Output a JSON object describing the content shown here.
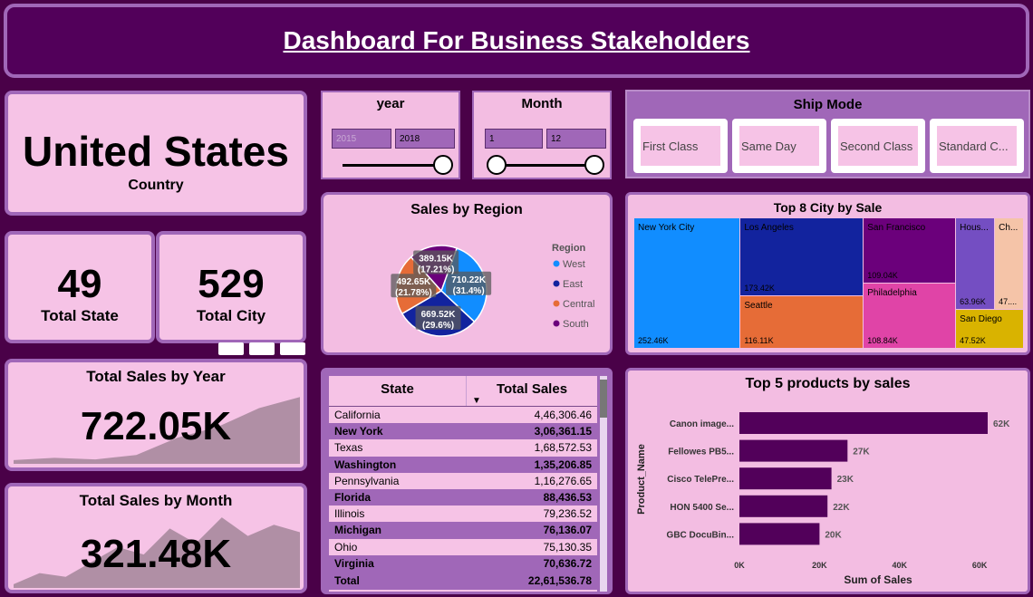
{
  "header": {
    "title": "Dashboard For Business Stakeholders"
  },
  "kpis": {
    "country": {
      "value": "United States",
      "label": "Country"
    },
    "total_state": {
      "value": "49",
      "label": "Total State"
    },
    "total_city": {
      "value": "529",
      "label": "Total City"
    },
    "sales_by_year": {
      "title": "Total Sales by Year",
      "value": "722.05K"
    },
    "sales_by_month": {
      "title": "Total Sales by Month",
      "value": "321.48K"
    }
  },
  "slicers": {
    "year": {
      "title": "year",
      "min": "2015",
      "max": "2018"
    },
    "month": {
      "title": "Month",
      "min": "1",
      "max": "12"
    },
    "ship_mode": {
      "title": "Ship Mode",
      "options": [
        "First Class",
        "Same Day",
        "Second Class",
        "Standard C..."
      ]
    }
  },
  "sales_by_region": {
    "title": "Sales by Region",
    "legend_title": "Region",
    "colors": [
      "#118dff",
      "#12239e",
      "#e66c37",
      "#6b007b"
    ]
  },
  "state_table": {
    "headers": [
      "State",
      "Total Sales"
    ],
    "rows": [
      [
        "California",
        "4,46,306.46"
      ],
      [
        "New York",
        "3,06,361.15"
      ],
      [
        "Texas",
        "1,68,572.53"
      ],
      [
        "Washington",
        "1,35,206.85"
      ],
      [
        "Pennsylvania",
        "1,16,276.65"
      ],
      [
        "Florida",
        "88,436.53"
      ],
      [
        "Illinois",
        "79,236.52"
      ],
      [
        "Michigan",
        "76,136.07"
      ],
      [
        "Ohio",
        "75,130.35"
      ],
      [
        "Virginia",
        "70,636.72"
      ]
    ],
    "total_label": "Total",
    "total_value": "22,61,536.78"
  },
  "top_cities": {
    "title": "Top 8 City by Sale"
  },
  "top_products": {
    "title": "Top 5 products by sales"
  },
  "chart_data": [
    {
      "type": "pie",
      "title": "Sales by Region",
      "legend_title": "Region",
      "categories": [
        "West",
        "East",
        "Central",
        "South"
      ],
      "values": [
        710.22,
        669.52,
        492.65,
        389.15
      ],
      "labels": [
        "710.22K\n(31.4%)",
        "669.52K\n(29.6%)",
        "492.65K\n(21.78%)",
        "389.15K\n(17.21%)"
      ],
      "unit": "K"
    },
    {
      "type": "treemap",
      "title": "Top 8 City by Sale",
      "categories": [
        "New York City",
        "Los Angeles",
        "San Francisco",
        "Hous...",
        "Ch...",
        "Seattle",
        "Philadelphia",
        "San Diego"
      ],
      "values": [
        252.46,
        173.42,
        109.04,
        63.96,
        47.0,
        116.11,
        108.84,
        47.52
      ],
      "labels": [
        "252.46K",
        "173.42K",
        "109.04K",
        "63.96K",
        "47....",
        "116.11K",
        "108.84K",
        "47.52K"
      ],
      "colors": [
        "#118dff",
        "#12239e",
        "#6b007b",
        "#744ec2",
        "#f5c4a8",
        "#e66c37",
        "#e044a7",
        "#d9b300"
      ]
    },
    {
      "type": "bar",
      "orientation": "horizontal",
      "title": "Top 5 products by sales",
      "categories": [
        "Canon image...",
        "Fellowes PB5...",
        "Cisco TelePre...",
        "HON 5400 Se...",
        "GBC DocuBin..."
      ],
      "values": [
        62,
        27,
        23,
        22,
        20
      ],
      "data_labels": [
        "62K",
        "27K",
        "23K",
        "22K",
        "20K"
      ],
      "xlabel": "Sum of Sales",
      "ylabel": "Product_Name",
      "xticks": [
        "0K",
        "20K",
        "40K",
        "60K"
      ],
      "xlim": [
        0,
        65
      ],
      "color": "#52005a"
    },
    {
      "type": "area",
      "title": "Total Sales by Year",
      "values": [
        0.05,
        0.08,
        0.06,
        0.12,
        0.35,
        0.5,
        0.75,
        0.9
      ],
      "color": "#b08fa5"
    },
    {
      "type": "area",
      "title": "Total Sales by Month",
      "values": [
        0.05,
        0.2,
        0.15,
        0.35,
        0.55,
        0.45,
        0.8,
        0.6,
        0.95,
        0.7,
        0.85,
        0.75
      ],
      "color": "#b08fa5"
    }
  ]
}
